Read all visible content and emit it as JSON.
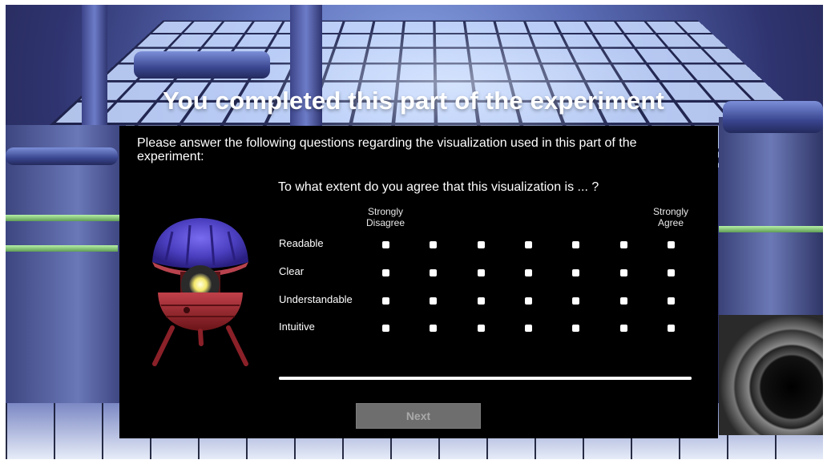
{
  "title": "You completed this part of the experiment",
  "panel": {
    "intro": "Please answer the following questions regarding the visualization used in this part of the experiment:",
    "question": "To what extent do you agree that this visualization is ... ?",
    "scale": {
      "low_label_line1": "Strongly",
      "low_label_line2": "Disagree",
      "high_label_line1": "Strongly",
      "high_label_line2": "Agree",
      "points": 7
    },
    "rows": [
      {
        "label": "Readable"
      },
      {
        "label": "Clear"
      },
      {
        "label": "Understandable"
      },
      {
        "label": "Intuitive"
      }
    ],
    "progress": 1.0,
    "next_label": "Next",
    "next_enabled": false
  },
  "colors": {
    "panel_bg": "#000000",
    "text": "#ffffff",
    "button_disabled": "#6e6e6e"
  }
}
